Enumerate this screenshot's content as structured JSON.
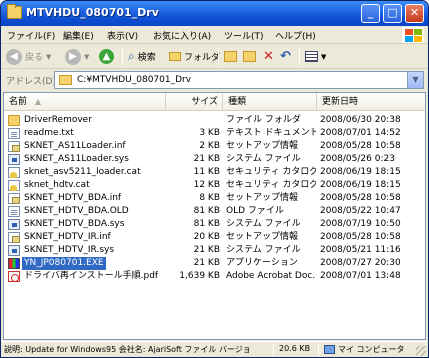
{
  "window": {
    "title": "MTVHDU_080701_Drv"
  },
  "title_buttons": {
    "minimize": "_",
    "maximize": "□",
    "close": "✕"
  },
  "menu": [
    "ファイル(F)",
    "編集(E)",
    "表示(V)",
    "お気に入り(A)",
    "ツール(T)",
    "ヘルプ(H)"
  ],
  "toolbar": {
    "back": "戻る",
    "search": "検索",
    "folders": "フォルダ"
  },
  "address": {
    "label": "アドレス(D)",
    "path": "C:¥MTVHDU_080701_Drv"
  },
  "columns": {
    "name": "名前",
    "size": "サイズ",
    "type": "種類",
    "date": "更新日時"
  },
  "files": [
    {
      "name": "DriverRemover",
      "size": "",
      "type": "ファイル フォルダ",
      "date": "2008/06/30 20:38",
      "icon": "folder"
    },
    {
      "name": "readme.txt",
      "size": "3 KB",
      "type": "テキスト ドキュメント",
      "date": "2008/07/01 14:52",
      "icon": "doc"
    },
    {
      "name": "SKNET_AS11Loader.inf",
      "size": "2 KB",
      "type": "セットアップ情報",
      "date": "2008/05/28 10:58",
      "icon": "inf"
    },
    {
      "name": "SKNET_AS11Loader.sys",
      "size": "21 KB",
      "type": "システム ファイル",
      "date": "2008/05/26 0:23",
      "icon": "sys"
    },
    {
      "name": "sknet_asv5211_loader.cat",
      "size": "11 KB",
      "type": "セキュリティ カタログ",
      "date": "2008/06/19 18:15",
      "icon": "cat"
    },
    {
      "name": "sknet_hdtv.cat",
      "size": "12 KB",
      "type": "セキュリティ カタログ",
      "date": "2008/06/19 18:15",
      "icon": "cat"
    },
    {
      "name": "SKNET_HDTV_BDA.inf",
      "size": "8 KB",
      "type": "セットアップ情報",
      "date": "2008/05/28 10:58",
      "icon": "inf"
    },
    {
      "name": "SKNET_HDTV_BDA.OLD",
      "size": "81 KB",
      "type": "OLD ファイル",
      "date": "2008/05/22 10:47",
      "icon": "doc"
    },
    {
      "name": "SKNET_HDTV_BDA.sys",
      "size": "81 KB",
      "type": "システム ファイル",
      "date": "2008/07/19 10:50",
      "icon": "sys"
    },
    {
      "name": "SKNET_HDTV_IR.inf",
      "size": "20 KB",
      "type": "セットアップ情報",
      "date": "2008/05/28 10:58",
      "icon": "inf"
    },
    {
      "name": "SKNET_HDTV_IR.sys",
      "size": "21 KB",
      "type": "システム ファイル",
      "date": "2008/05/21 11:16",
      "icon": "sys"
    },
    {
      "name": "YN_JP080701.EXE",
      "size": "21 KB",
      "type": "アプリケーション",
      "date": "2008/07/27 20:30",
      "icon": "exe",
      "selected": true
    },
    {
      "name": "ドライバ再インストール手順.pdf",
      "size": "1,639 KB",
      "type": "Adobe Acrobat Doc...",
      "date": "2008/07/01 13:48",
      "icon": "pdf"
    }
  ],
  "status": {
    "description": "説明: Update for Windows95 会社名: AjariSoft ファイル バージョ",
    "size": "20.6 KB",
    "location": "マイ コンピュータ"
  }
}
